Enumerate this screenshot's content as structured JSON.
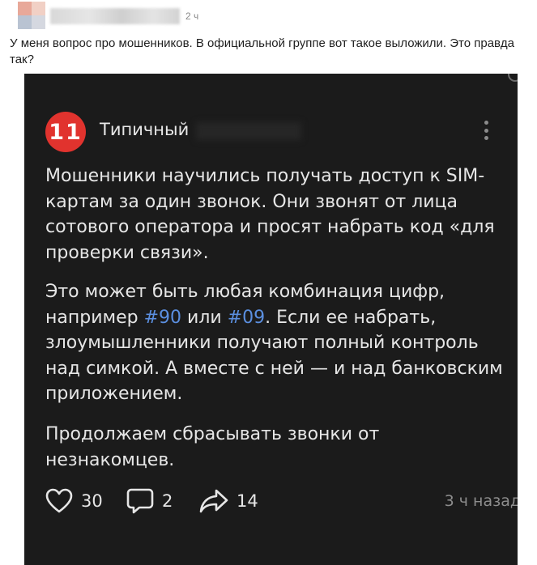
{
  "post": {
    "time": "2 ч",
    "text": "У меня вопрос про мошенников. В официальной группе вот такое выложили. Это правда так?"
  },
  "screenshot": {
    "channel": {
      "logo_text": "11",
      "name": "Типичный",
      "logo_color": "#e1332e"
    },
    "paragraph1": "Мошенники научились получать доступ к SIM-картам за один звонок. Они звонят от лица сотового оператора и просят набрать код «для проверки связи».",
    "paragraph2": {
      "before": "Это может быть любая комбинация цифр, например ",
      "tag1": "#90",
      "middle": " или ",
      "tag2": "#09",
      "after": ". Если ее набрать, злоумышленники получают полный контроль над симкой. А вместе с ней — и над банковским приложением."
    },
    "paragraph3": "Продолжаем сбрасывать звонки от незнакомцев.",
    "actions": {
      "likes": "30",
      "comments": "2",
      "shares": "14",
      "time_ago": "3 ч назад"
    },
    "icons": {
      "like": "heart-icon",
      "comment": "comment-bubble-icon",
      "share": "share-arrow-icon",
      "menu": "more-vertical-icon"
    },
    "colors": {
      "background": "#1b1b1b",
      "hashtag": "#5b8fe0",
      "text": "#e6e6e6"
    }
  }
}
